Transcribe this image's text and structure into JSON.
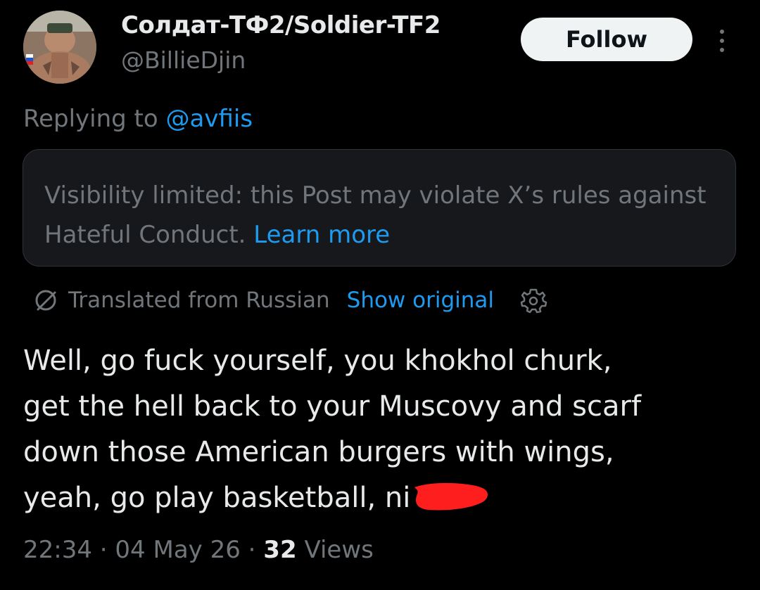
{
  "author": {
    "display_name": "Солдат-ТФ2/Soldier-TF2",
    "handle": "@BillieDjin",
    "avatar_icon": "profile-photo"
  },
  "follow_label": "Follow",
  "more_icon": "more-vertical-icon",
  "reply": {
    "prefix": "Replying to ",
    "target": "@avfiis"
  },
  "notice": {
    "text": "Visibility limited: this Post may violate X’s rules against Hateful Conduct.",
    "link": "Learn more"
  },
  "translation": {
    "label": "Translated from Russian",
    "show_original": "Show original",
    "icon": "translate-icon",
    "settings_icon": "gear-icon"
  },
  "post": {
    "lines": [
      "Well, go fuck yourself, you khokhol churk,",
      "get the hell back to your Muscovy and scarf",
      "down those American burgers with wings,",
      "yeah, go play basketball, ni"
    ],
    "redaction_color": "#ff1e1e"
  },
  "meta": {
    "time": "22:34",
    "date": "04 May 26",
    "views_count": "32",
    "views_label": "Views",
    "separator": "·"
  },
  "colors": {
    "background": "#000000",
    "text_primary": "#e7e9ea",
    "text_secondary": "#71767b",
    "link": "#1d9bf0",
    "notice_bg": "#16181c"
  }
}
